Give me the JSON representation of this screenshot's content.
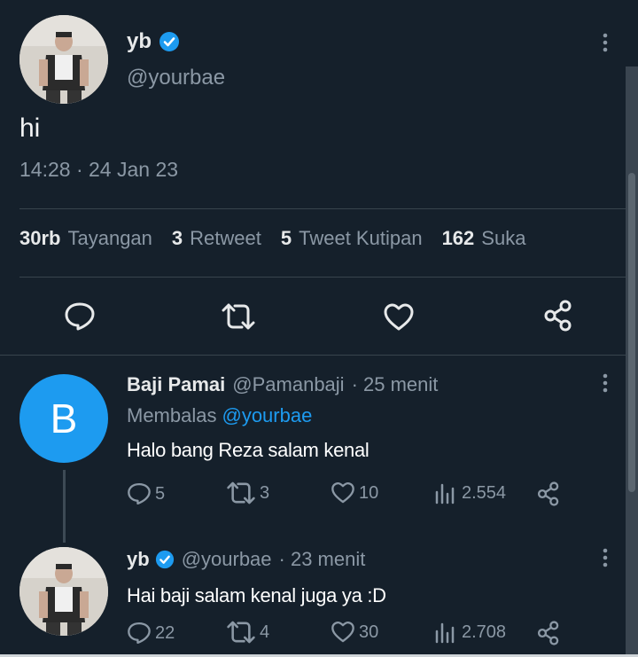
{
  "main_tweet": {
    "name": "yb",
    "handle": "@yourbae",
    "text": "hi",
    "timestamp": "14:28 · 24 Jan 23",
    "stats": [
      {
        "value": "30rb",
        "label": "Tayangan"
      },
      {
        "value": "3",
        "label": "Retweet"
      },
      {
        "value": "5",
        "label": "Tweet Kutipan"
      },
      {
        "value": "162",
        "label": "Suka"
      }
    ]
  },
  "replies": [
    {
      "avatar_letter": "B",
      "name": "Baji Pamai",
      "handle": "@Pamanbaji",
      "time": "· 25 menit",
      "replying_prefix": "Membalas",
      "replying_to": "@yourbae",
      "text": "Halo bang Reza salam kenal",
      "replies": "5",
      "retweets": "3",
      "likes": "10",
      "views": "2.554"
    },
    {
      "name": "yb",
      "handle": "@yourbae",
      "time": "· 23 menit",
      "text": "Hai baji salam kenal juga ya :D",
      "replies": "22",
      "retweets": "4",
      "likes": "30",
      "views": "2.708"
    }
  ],
  "colors": {
    "background": "#15202b",
    "accent": "#1d9bf0",
    "muted": "#8b98a5",
    "text": "#e7e9ea"
  }
}
